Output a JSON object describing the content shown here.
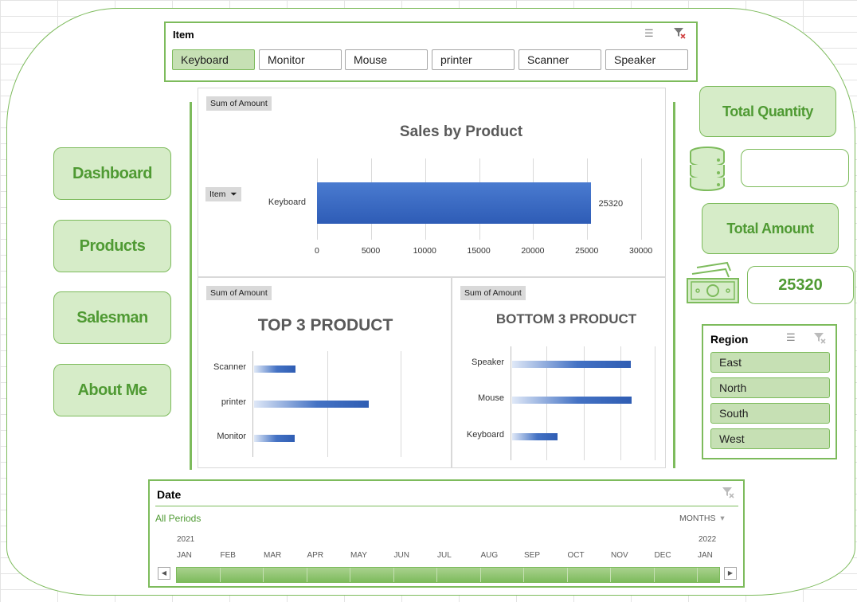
{
  "item_slicer": {
    "title": "Item",
    "items": [
      {
        "label": "Keyboard",
        "selected": true
      },
      {
        "label": "Monitor",
        "selected": false
      },
      {
        "label": "Mouse",
        "selected": false
      },
      {
        "label": "printer",
        "selected": false
      },
      {
        "label": "Scanner",
        "selected": false
      },
      {
        "label": "Speaker",
        "selected": false
      }
    ],
    "icons": [
      "multi-select-icon",
      "clear-filter-icon"
    ]
  },
  "nav": {
    "dashboard": "Dashboard",
    "products": "Products",
    "salesman": "Salesman",
    "about": "About Me"
  },
  "kpi": {
    "total_quantity_label": "Total Quantity",
    "total_quantity_value": "",
    "total_amount_label": "Total Amount",
    "total_amount_value": "25320",
    "icons": [
      "database-icon",
      "cash-icon"
    ]
  },
  "region_slicer": {
    "title": "Region",
    "items": [
      "East",
      "North",
      "South",
      "West"
    ]
  },
  "date_timeline": {
    "title": "Date",
    "period": "All Periods",
    "granularity": "MONTHS",
    "year_start": "2021",
    "year_end": "2022",
    "months": [
      "JAN",
      "FEB",
      "MAR",
      "APR",
      "MAY",
      "JUN",
      "JUL",
      "AUG",
      "SEP",
      "OCT",
      "NOV",
      "DEC",
      "JAN"
    ]
  },
  "field_buttons": {
    "sum_of_amount": "Sum of Amount",
    "item_filter": "Item"
  },
  "accent_color": "#7dbb5c",
  "bar_color": "#4472c4",
  "chart_data": [
    {
      "type": "bar",
      "title": "Sales by Product",
      "categories": [
        "Keyboard"
      ],
      "values": [
        25320
      ],
      "data_labels": [
        "25320"
      ],
      "xlim": [
        0,
        30000
      ],
      "ticks": [
        "0",
        "5000",
        "10000",
        "15000",
        "20000",
        "25000",
        "30000"
      ],
      "grid": true
    },
    {
      "type": "bar",
      "title": "TOP 3 PRODUCT",
      "categories": [
        "Scanner",
        "printer",
        "Monitor"
      ],
      "values": [
        2300,
        6300,
        2250
      ],
      "xlim": [
        0,
        10000
      ],
      "grid": true
    },
    {
      "type": "bar",
      "title": "BOTTOM 3 PRODUCT",
      "categories": [
        "Speaker",
        "Mouse",
        "Keyboard"
      ],
      "values": [
        3200,
        3220,
        1220
      ],
      "xlim": [
        0,
        4000
      ],
      "grid": true
    }
  ]
}
